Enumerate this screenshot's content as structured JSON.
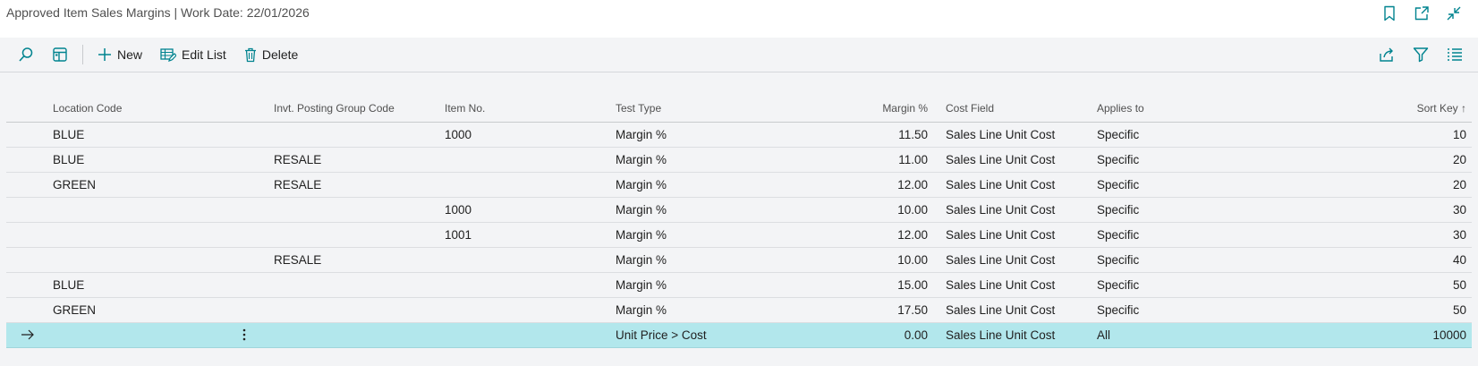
{
  "window": {
    "title": "Approved Item Sales Margins | Work Date: 22/01/2026",
    "icons": [
      "bookmark-icon",
      "open-in-new-window-icon",
      "collapse-icon"
    ]
  },
  "actions": {
    "search_icon": "search-icon",
    "view_icon": "table-view-icon",
    "new_label": "New",
    "edit_list_label": "Edit List",
    "delete_label": "Delete",
    "right_icons": [
      "share-icon",
      "filter-icon",
      "list-view-icon"
    ]
  },
  "table": {
    "headers": {
      "location_code": "Location Code",
      "posting_group": "Invt. Posting Group Code",
      "item_no": "Item No.",
      "test_type": "Test Type",
      "margin": "Margin %",
      "cost_field": "Cost Field",
      "applies_to": "Applies to",
      "sort_key": "Sort Key",
      "sort_indicator": "↑"
    },
    "rows": [
      {
        "location_code": "BLUE",
        "posting_group": "",
        "item_no": "1000",
        "test_type": "Margin %",
        "margin": "11.50",
        "cost_field": "Sales Line Unit Cost",
        "applies_to": "Specific",
        "sort_key": "10"
      },
      {
        "location_code": "BLUE",
        "posting_group": "RESALE",
        "item_no": "",
        "test_type": "Margin %",
        "margin": "11.00",
        "cost_field": "Sales Line Unit Cost",
        "applies_to": "Specific",
        "sort_key": "20"
      },
      {
        "location_code": "GREEN",
        "posting_group": "RESALE",
        "item_no": "",
        "test_type": "Margin %",
        "margin": "12.00",
        "cost_field": "Sales Line Unit Cost",
        "applies_to": "Specific",
        "sort_key": "20"
      },
      {
        "location_code": "",
        "posting_group": "",
        "item_no": "1000",
        "test_type": "Margin %",
        "margin": "10.00",
        "cost_field": "Sales Line Unit Cost",
        "applies_to": "Specific",
        "sort_key": "30"
      },
      {
        "location_code": "",
        "posting_group": "",
        "item_no": "1001",
        "test_type": "Margin %",
        "margin": "12.00",
        "cost_field": "Sales Line Unit Cost",
        "applies_to": "Specific",
        "sort_key": "30"
      },
      {
        "location_code": "",
        "posting_group": "RESALE",
        "item_no": "",
        "test_type": "Margin %",
        "margin": "10.00",
        "cost_field": "Sales Line Unit Cost",
        "applies_to": "Specific",
        "sort_key": "40"
      },
      {
        "location_code": "BLUE",
        "posting_group": "",
        "item_no": "",
        "test_type": "Margin %",
        "margin": "15.00",
        "cost_field": "Sales Line Unit Cost",
        "applies_to": "Specific",
        "sort_key": "50"
      },
      {
        "location_code": "GREEN",
        "posting_group": "",
        "item_no": "",
        "test_type": "Margin %",
        "margin": "17.50",
        "cost_field": "Sales Line Unit Cost",
        "applies_to": "Specific",
        "sort_key": "50"
      },
      {
        "location_code": "",
        "posting_group": "",
        "item_no": "",
        "test_type": "Unit Price > Cost",
        "margin": "0.00",
        "cost_field": "Sales Line Unit Cost",
        "applies_to": "All",
        "sort_key": "10000",
        "selected": true
      }
    ]
  },
  "colors": {
    "accent": "#00838f",
    "selected_row": "#b2e7ec",
    "background": "#f3f4f6"
  }
}
